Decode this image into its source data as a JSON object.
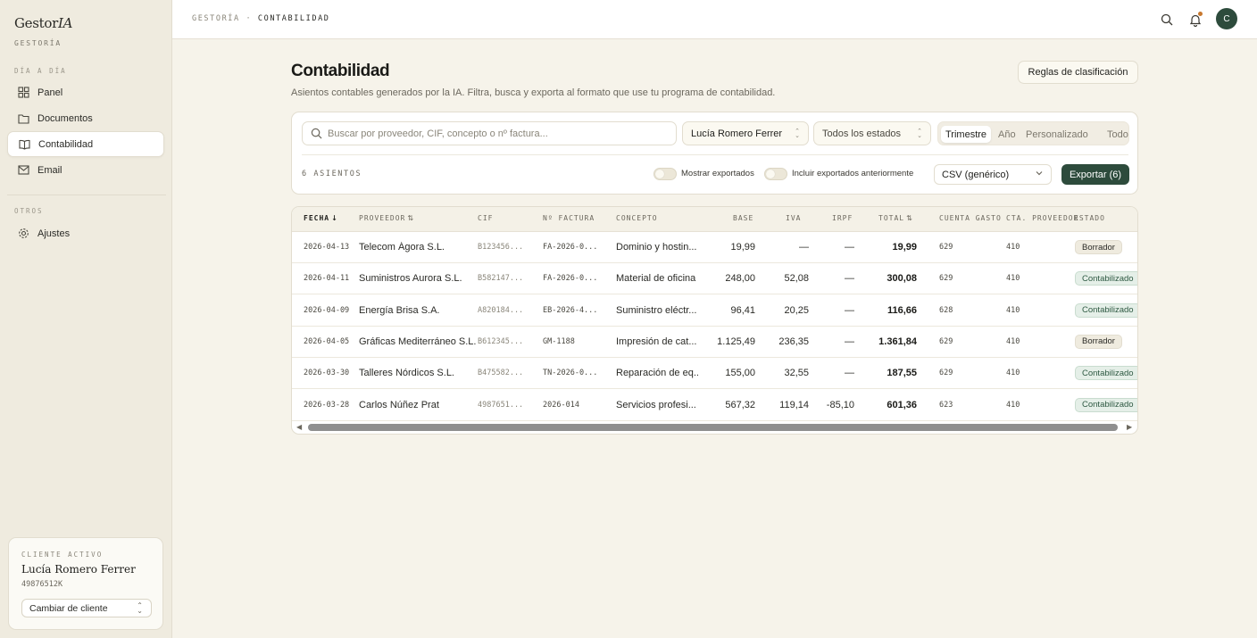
{
  "brand": {
    "name": "Gestor",
    "name_italic": "IA",
    "sub": "GESTORÍA"
  },
  "sidebar": {
    "section_daily": "DÍA A DÍA",
    "items": [
      {
        "label": "Panel",
        "icon": "grid-icon"
      },
      {
        "label": "Documentos",
        "icon": "folder-icon"
      },
      {
        "label": "Contabilidad",
        "icon": "book-icon",
        "active": true
      },
      {
        "label": "Email",
        "icon": "mail-icon"
      }
    ],
    "section_other": "OTROS",
    "settings_label": "Ajustes"
  },
  "client": {
    "label": "CLIENTE ACTIVO",
    "name": "Lucía Romero Ferrer",
    "id": "49876512K",
    "change_label": "Cambiar de cliente"
  },
  "topbar": {
    "crumb_root": "GESTORÍA",
    "crumb_sep": "·",
    "crumb_current": "CONTABILIDAD",
    "avatar_initial": "C"
  },
  "page": {
    "title": "Contabilidad",
    "subtitle": "Asientos contables generados por la IA. Filtra, busca y exporta al formato que use tu programa de contabilidad.",
    "rules_button": "Reglas de clasificación"
  },
  "filters": {
    "search_placeholder": "Buscar por proveedor, CIF, concepto o nº factura...",
    "client_select": "Lucía Romero Ferrer",
    "status_select": "Todos los estados",
    "periods": [
      "Trimestre",
      "Año",
      "Personalizado",
      "Todo"
    ],
    "period_selected": "Trimestre",
    "count_label": "6 ASIENTOS",
    "toggle_exported": "Mostrar exportados",
    "toggle_previous": "Incluir exportados anteriormente",
    "format": "CSV (genérico)",
    "export_button": "Exportar (6)"
  },
  "table": {
    "columns": [
      "FECHA",
      "PROVEEDOR",
      "CIF",
      "Nº FACTURA",
      "CONCEPTO",
      "BASE",
      "IVA",
      "IRPF",
      "TOTAL",
      "CUENTA GASTO",
      "CTA. PROVEEDOR",
      "ESTADO"
    ],
    "rows": [
      {
        "fecha": "2026-04-13",
        "proveedor": "Telecom Ágora S.L.",
        "cif": "B123456...",
        "factura": "FA-2026-0...",
        "concepto": "Dominio y hostin...",
        "base": "19,99",
        "iva": "—",
        "irpf": "—",
        "total": "19,99",
        "cuenta": "629",
        "cta_prov": "410",
        "estado": "Borrador",
        "status_type": "draft"
      },
      {
        "fecha": "2026-04-11",
        "proveedor": "Suministros Aurora S.L.",
        "cif": "B582147...",
        "factura": "FA-2026-0...",
        "concepto": "Material de oficina",
        "base": "248,00",
        "iva": "52,08",
        "irpf": "—",
        "total": "300,08",
        "cuenta": "629",
        "cta_prov": "410",
        "estado": "Contabilizado",
        "status_type": "done"
      },
      {
        "fecha": "2026-04-09",
        "proveedor": "Energía Brisa S.A.",
        "cif": "A820184...",
        "factura": "EB-2026-4...",
        "concepto": "Suministro eléctr...",
        "base": "96,41",
        "iva": "20,25",
        "irpf": "—",
        "total": "116,66",
        "cuenta": "628",
        "cta_prov": "410",
        "estado": "Contabilizado",
        "status_type": "done"
      },
      {
        "fecha": "2026-04-05",
        "proveedor": "Gráficas Mediterráneo S.L.",
        "cif": "B612345...",
        "factura": "GM-1188",
        "concepto": "Impresión de cat...",
        "base": "1.125,49",
        "iva": "236,35",
        "irpf": "—",
        "total": "1.361,84",
        "cuenta": "629",
        "cta_prov": "410",
        "estado": "Borrador",
        "status_type": "draft"
      },
      {
        "fecha": "2026-03-30",
        "proveedor": "Talleres Nórdicos S.L.",
        "cif": "B475582...",
        "factura": "TN-2026-0...",
        "concepto": "Reparación de eq...",
        "base": "155,00",
        "iva": "32,55",
        "irpf": "—",
        "total": "187,55",
        "cuenta": "629",
        "cta_prov": "410",
        "estado": "Contabilizado",
        "status_type": "done"
      },
      {
        "fecha": "2026-03-28",
        "proveedor": "Carlos Núñez Prat",
        "cif": "4987651...",
        "factura": "2026-014",
        "concepto": "Servicios profesi...",
        "base": "567,32",
        "iva": "119,14",
        "irpf": "-85,10",
        "total": "601,36",
        "cuenta": "623",
        "cta_prov": "410",
        "estado": "Contabilizado",
        "status_type": "done"
      }
    ]
  }
}
